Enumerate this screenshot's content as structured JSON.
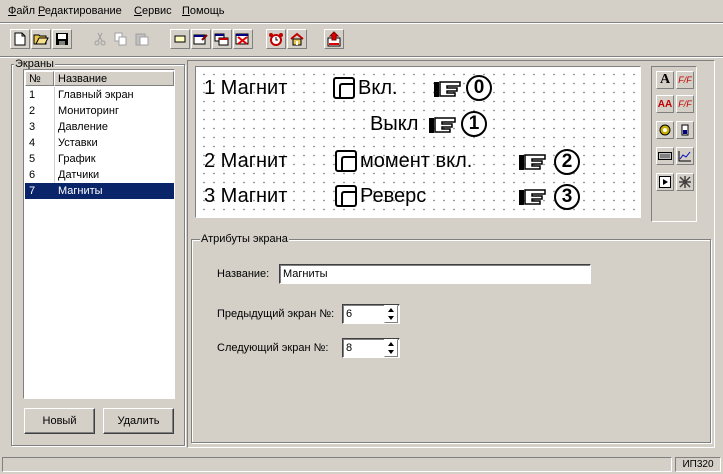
{
  "menu": {
    "items": [
      "Файл",
      "Редактирование",
      "Сервис",
      "Помощь"
    ]
  },
  "toolbar": {
    "buttons": [
      "new-doc-icon",
      "open-folder-icon",
      "save-icon",
      "cut-icon",
      "copy-icon",
      "paste-icon",
      "add-screen-icon",
      "screen-props-icon",
      "copy-screen-icon",
      "delete-screen-icon",
      "alarm-clock-icon",
      "home-icon",
      "export-icon"
    ]
  },
  "screens_panel": {
    "title": "Экраны",
    "columns": [
      "№",
      "Название"
    ],
    "rows": [
      {
        "num": "1",
        "name": "Главный экран"
      },
      {
        "num": "2",
        "name": "Мониторинг"
      },
      {
        "num": "3",
        "name": "Давление"
      },
      {
        "num": "4",
        "name": "Уставки"
      },
      {
        "num": "5",
        "name": "График"
      },
      {
        "num": "6",
        "name": "Датчики"
      },
      {
        "num": "7",
        "name": "Магниты"
      }
    ],
    "selected_index": 6,
    "new_button": "Новый",
    "delete_button": "Удалить"
  },
  "canvas": {
    "rows": [
      {
        "label": "1 Магнит",
        "switch": "Вкл.",
        "key": "0"
      },
      {
        "label": "",
        "switch": "Выкл",
        "key": "1"
      },
      {
        "label": "2 Магнит",
        "switch": "момент вкл.",
        "key": "2"
      },
      {
        "label": "3 Магнит",
        "switch": "Реверс",
        "key": "3"
      }
    ]
  },
  "right_tools": [
    "A",
    "F/F",
    "AA",
    "F/F",
    "o",
    "i",
    "bar",
    "chart",
    "play",
    "pattern"
  ],
  "attributes": {
    "title": "Атрибуты экрана",
    "name_label": "Название:",
    "name_value": "Магниты",
    "prev_label": "Предыдущий экран №:",
    "prev_value": "6",
    "next_label": "Следующий экран №:",
    "next_value": "8"
  },
  "status": {
    "text": "ИП320"
  },
  "colors": {
    "face": "#d4d0c8",
    "selection": "#0a246a"
  }
}
